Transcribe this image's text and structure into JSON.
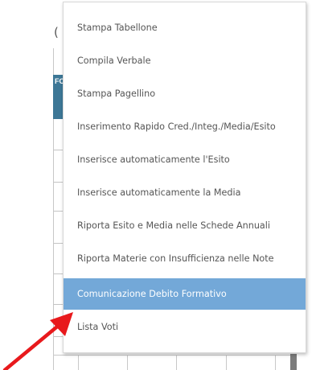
{
  "background": {
    "partial_text": "(",
    "header_partial": "FC"
  },
  "menu": {
    "items": [
      {
        "label": "Stampa Tabellone"
      },
      {
        "label": "Compila Verbale"
      },
      {
        "label": "Stampa Pagellino"
      },
      {
        "label": "Inserimento Rapido Cred./Integ./Media/Esito"
      },
      {
        "label": "Inserisce automaticamente l'Esito"
      },
      {
        "label": "Inserisce automaticamente la Media"
      },
      {
        "label": "Riporta Esito e Media nelle Schede Annuali"
      },
      {
        "label": "Riporta Materie con Insufficienza nelle Note"
      },
      {
        "label": "Comunicazione Debito Formativo",
        "selected": true
      },
      {
        "label": "Lista Voti"
      }
    ]
  },
  "colors": {
    "selected_item": "#73a8d8",
    "header_bar": "#3d7796",
    "arrow": "#e8191c"
  },
  "annotation": {
    "arrow_icon": "red-arrow-icon"
  }
}
